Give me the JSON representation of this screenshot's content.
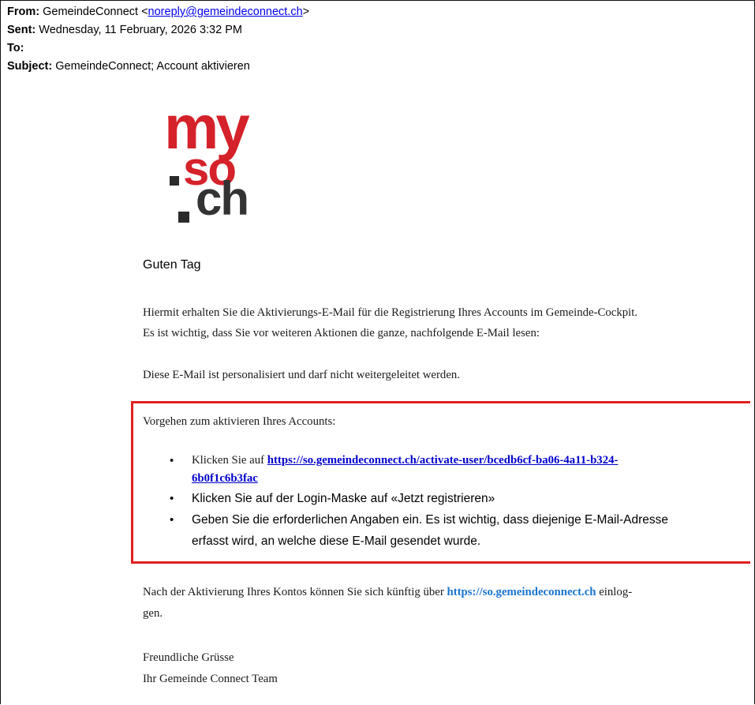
{
  "header": {
    "from_label": "From:",
    "from_name": "GemeindeConnect",
    "from_email": "noreply@gemeindeconnect.ch",
    "sent_label": "Sent:",
    "sent_value": "Wednesday, 11 February, 2026 3:32 PM",
    "to_label": "To:",
    "subject_label": "Subject:",
    "subject_value": "GemeindeConnect; Account aktivieren"
  },
  "logo": {
    "line1": "my",
    "line2": "so",
    "line3": "ch"
  },
  "body": {
    "greeting": "Guten Tag",
    "intro_line1": "Hiermit erhalten Sie die Aktivierungs-E-Mail für die Registrierung Ihres Accounts im Gemeinde-Cockpit.",
    "intro_line2": "Es ist wichtig, dass Sie vor weiteren Aktionen die ganze, nachfolgende E-Mail lesen:",
    "notice": "Diese E-Mail ist personalisiert und darf nicht weitergeleitet werden.",
    "box_title": "Vorgehen zum aktivieren Ihres Accounts:",
    "step1_prefix": "Klicken Sie auf ",
    "step1_link_a": "https://so.gemeindeconnect.ch/activate-user/bcedb6cf-ba06-4a11-b324-",
    "step1_link_b": "6b0f1c6b3fac",
    "step2": "Klicken Sie auf der Login-Maske auf «Jetzt registrieren»",
    "step3_line1": "Geben Sie die erforderlichen Angaben ein. Es ist wichtig, dass diejenige E-Mail-Adresse",
    "step3_line2": "erfasst wird, an welche diese E-Mail gesendet wurde.",
    "after_prefix": "Nach der Aktivierung Ihres Kontos können Sie sich künftig über ",
    "after_link": "https://so.gemeindeconnect.ch",
    "after_suffix": " einlog-",
    "after_line2": "gen.",
    "closing1": "Freundliche Grüsse",
    "closing2": "Ihr Gemeinde Connect Team"
  },
  "colors": {
    "brand_red": "#d5222a",
    "brand_dark": "#333333",
    "box_border": "#e02020",
    "link": "#0000cc"
  }
}
